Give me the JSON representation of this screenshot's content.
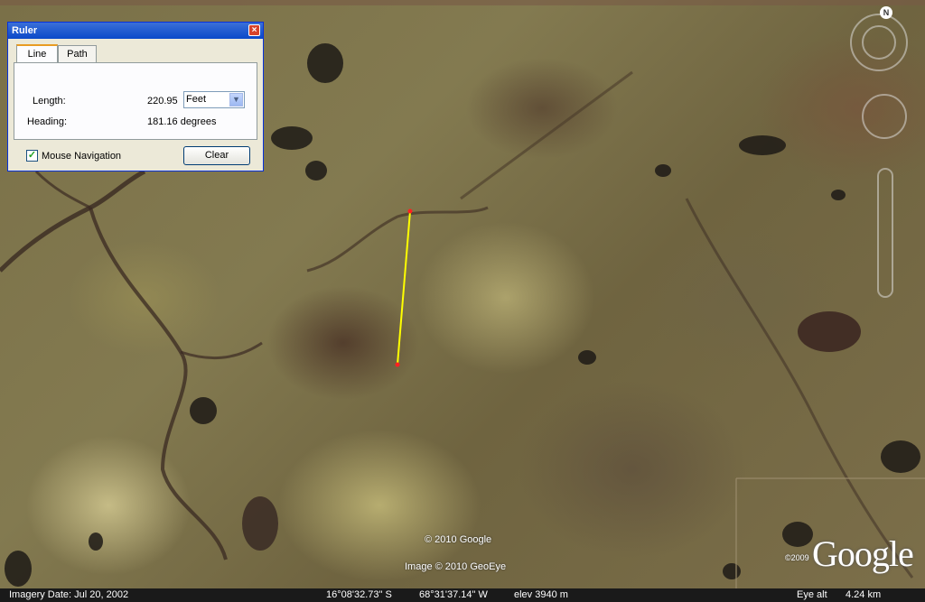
{
  "ruler": {
    "title": "Ruler",
    "close_glyph": "×",
    "tabs": [
      {
        "label": "Line",
        "active": true
      },
      {
        "label": "Path",
        "active": false
      }
    ],
    "length_label": "Length:",
    "length_value": "220.95",
    "unit_selected": "Feet",
    "heading_label": "Heading:",
    "heading_value": "181.16 degrees",
    "mouse_nav_label": "Mouse Navigation",
    "mouse_nav_checked": true,
    "clear_label": "Clear"
  },
  "nav": {
    "north_label": "N",
    "icons": [
      "compass-ring-icon",
      "look-joystick-icon",
      "zoom-slider-icon"
    ]
  },
  "map": {
    "measure_line_color": "#ffff00",
    "endpoint_color": "#ff2020",
    "copyright_google": "© 2010 Google",
    "copyright_geoeye": "Image © 2010 GeoEye",
    "logo_text": "Google",
    "logo_copyright": "©2009"
  },
  "status": {
    "imagery_date": "Imagery Date: Jul 20, 2002",
    "latitude": "16°08'32.73\" S",
    "longitude": "68°31'37.14\" W",
    "elevation": "elev 3940 m",
    "eye_alt_label": "Eye alt",
    "eye_alt_value": "4.24 km"
  }
}
